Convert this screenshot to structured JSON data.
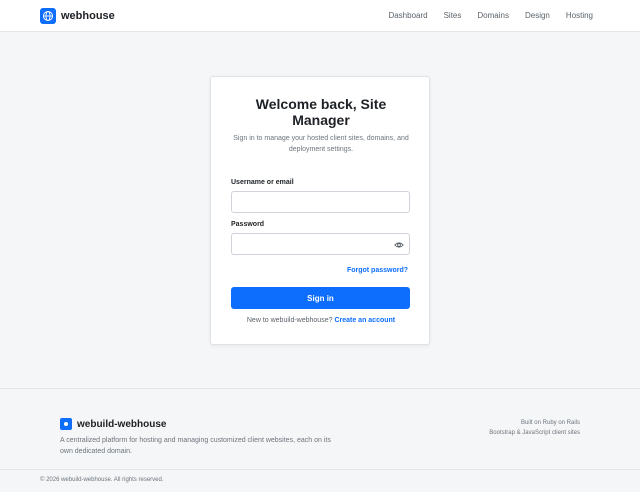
{
  "header": {
    "brand": "webhouse",
    "nav": [
      "Dashboard",
      "Sites",
      "Domains",
      "Design",
      "Hosting"
    ]
  },
  "login": {
    "title": "Welcome back, Site Manager",
    "subtitle": "Sign in to manage your hosted client sites, domains, and deployment settings.",
    "username_label": "Username or email",
    "username_value": "",
    "password_label": "Password",
    "password_value": "",
    "forgot_label": "Forgot password?",
    "signin_label": "Sign in",
    "signup_text": "New to webuild-webhouse?",
    "signup_link": "Create an account"
  },
  "footer": {
    "brand": "webuild-webhouse",
    "description": "A centralized platform for hosting and managing customized client websites, each on its own dedicated domain.",
    "right_lines": [
      "Built on Ruby on Rails",
      "Bootstrap & JavaScript client sites"
    ],
    "copyright": "© 2026 webuild-webhouse. All rights reserved."
  },
  "colors": {
    "accent": "#0d6efd",
    "background": "#f5f6f7",
    "card": "#ffffff"
  },
  "icons": {
    "brand": "globe-icon",
    "password_toggle": "eye-icon",
    "footer_brand": "dot-logo-icon"
  }
}
